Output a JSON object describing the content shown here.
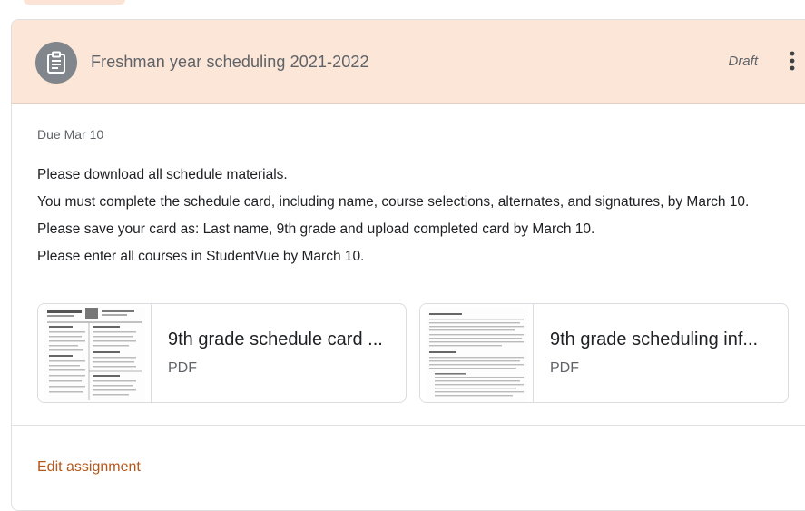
{
  "assignment": {
    "title": "Freshman year scheduling 2021-2022",
    "status": "Draft",
    "icon": "assignment-icon",
    "more_icon": "more-vert-icon",
    "due": "Due Mar 10",
    "instructions": [
      "Please download all schedule materials.",
      "You must complete the schedule card, including name, course selections, alternates, and signatures, by March 10.",
      "Please save your card as: Last name, 9th grade and upload completed card by March 10.",
      "Please enter all courses in StudentVue by March 10."
    ],
    "attachments": [
      {
        "title": "9th grade schedule card ...",
        "type": "PDF"
      },
      {
        "title": "9th grade scheduling inf...",
        "type": "PDF"
      }
    ],
    "edit_label": "Edit assignment"
  },
  "colors": {
    "header_bg": "#fbe6d8",
    "accent": "#b5561a",
    "icon_circle": "#80868b"
  }
}
